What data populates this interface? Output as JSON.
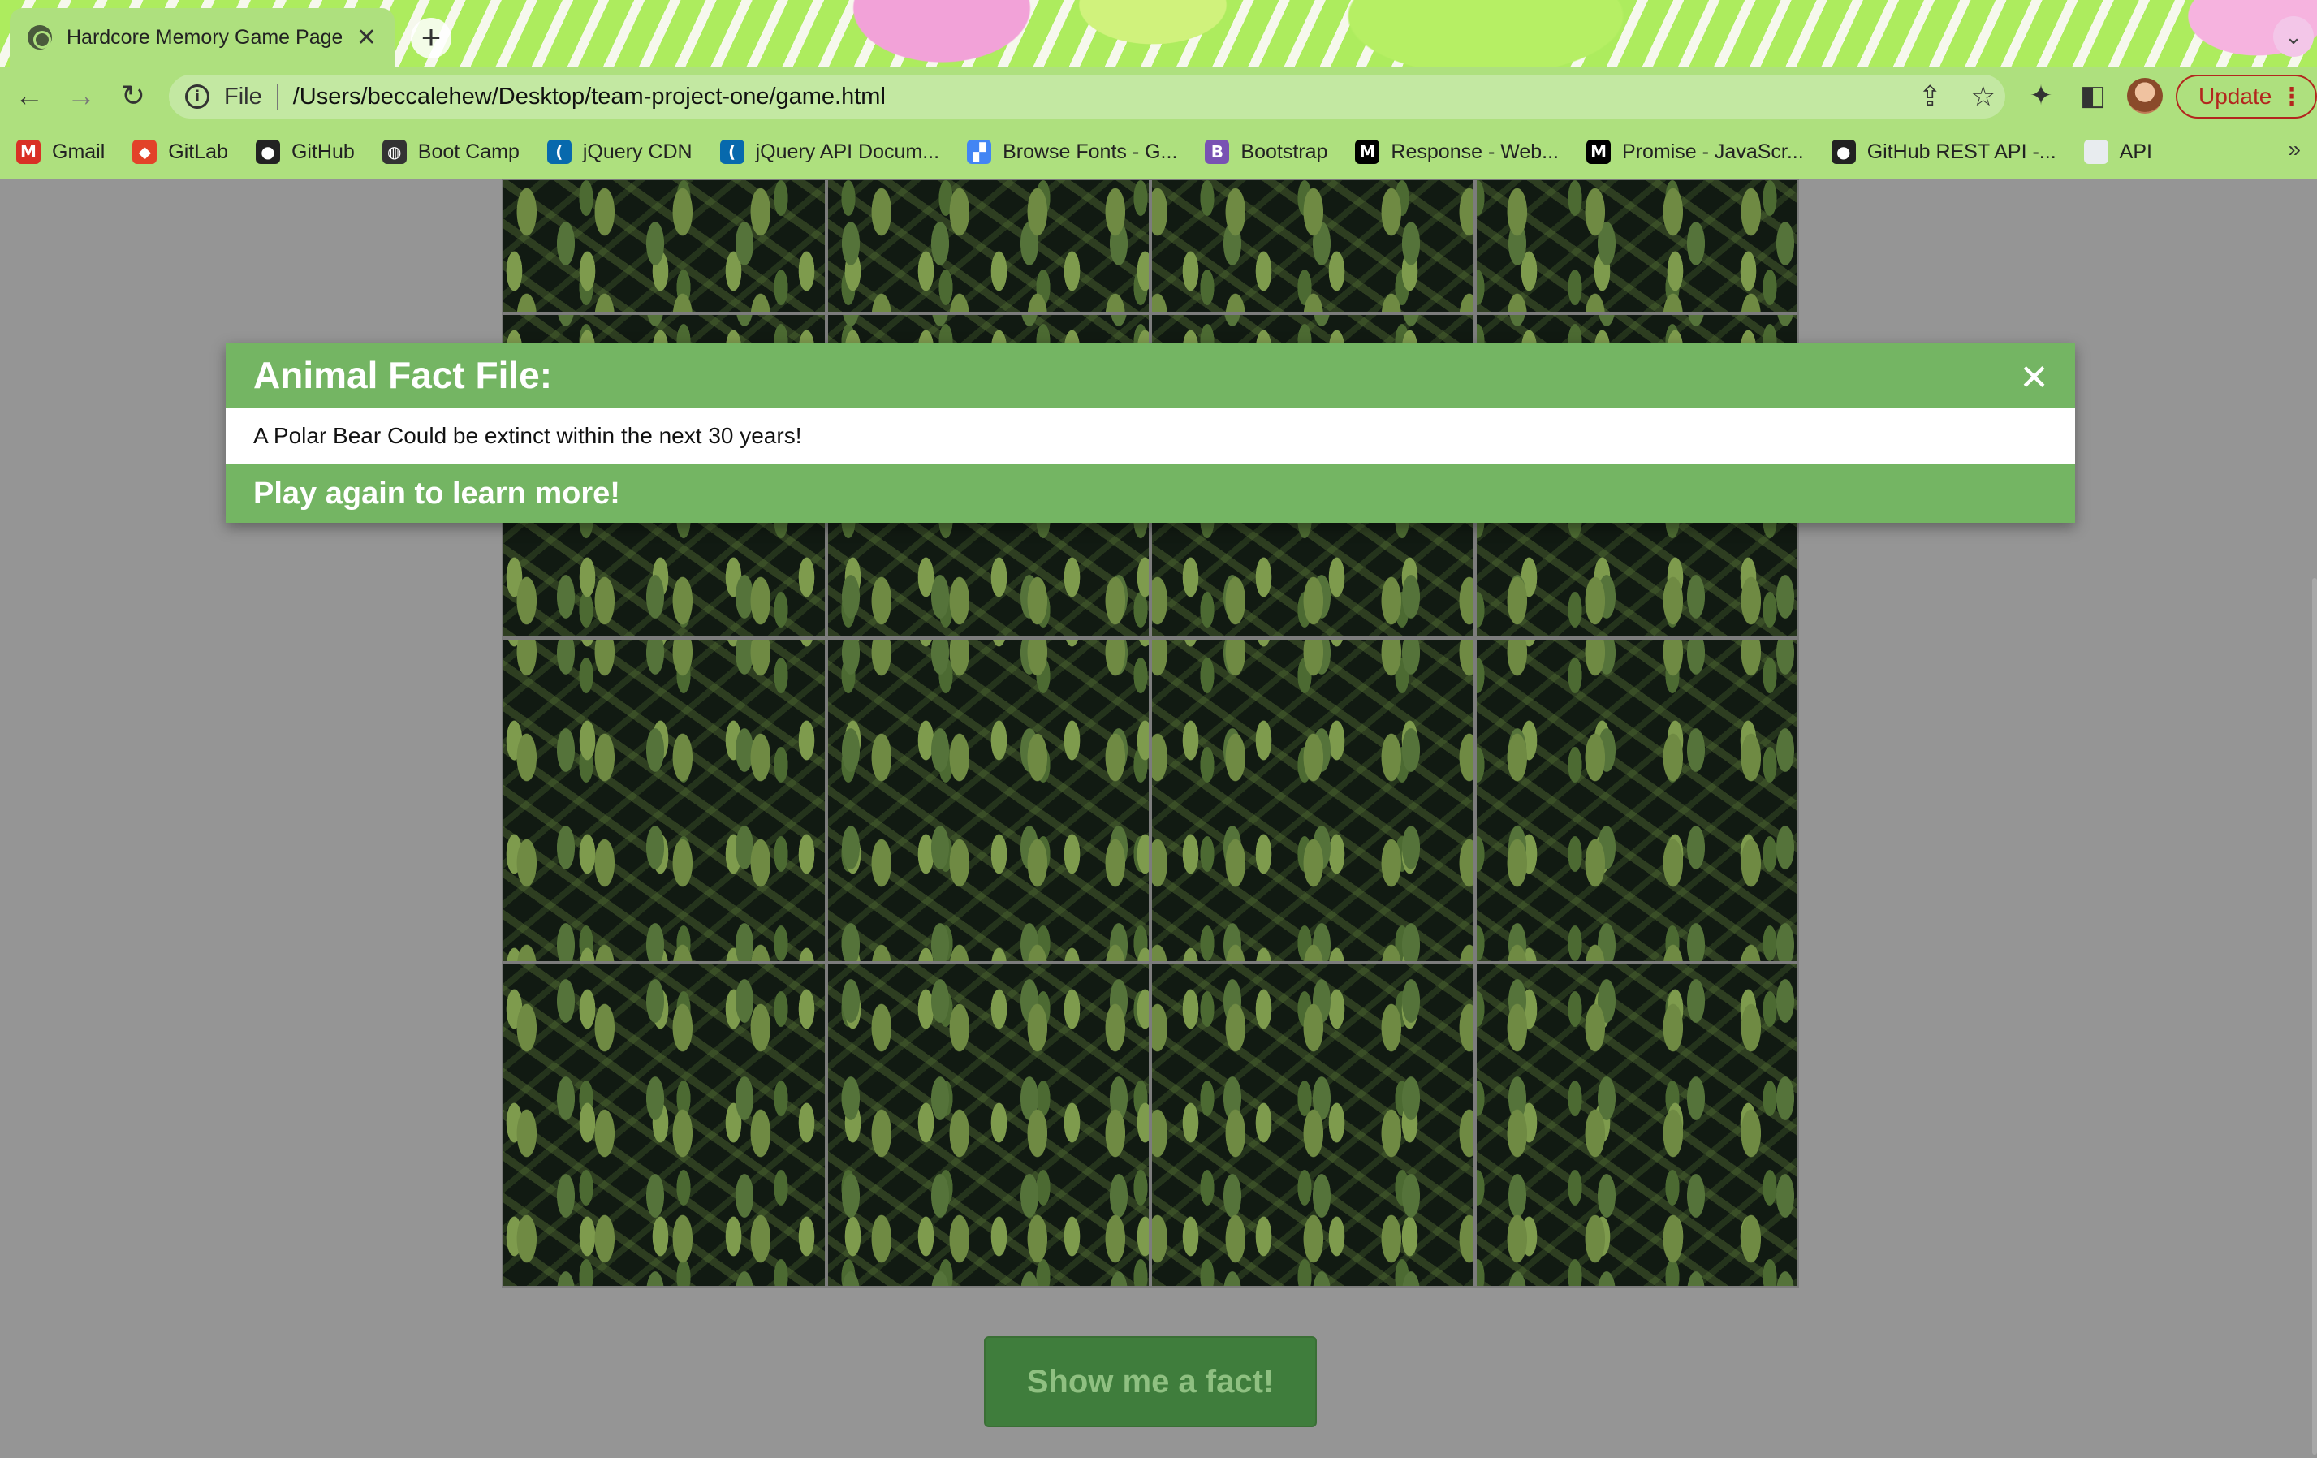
{
  "browser": {
    "tab": {
      "title": "Hardcore Memory Game Page",
      "close": "✕"
    },
    "new_tab": "+",
    "tab_list": "⌄",
    "nav": {
      "back": "←",
      "forward": "→",
      "reload": "↻"
    },
    "address": {
      "scheme": "File",
      "url": "/Users/beccalehew/Desktop/team-project-one/game.html"
    },
    "icons": {
      "share": "⇪",
      "star": "☆",
      "extensions": "✦",
      "sidepanel": "◧"
    },
    "update_label": "Update",
    "menu": "⋮",
    "bookmarks": [
      {
        "label": "Gmail",
        "icon": "gmail-icon",
        "color": "#d93025",
        "glyph": "M"
      },
      {
        "label": "GitLab",
        "icon": "gitlab-icon",
        "color": "#e24329",
        "glyph": "◆"
      },
      {
        "label": "GitHub",
        "icon": "github-icon",
        "color": "#222222",
        "glyph": "●"
      },
      {
        "label": "Boot Camp",
        "icon": "globe-icon",
        "color": "#333333",
        "glyph": "◍"
      },
      {
        "label": "jQuery CDN",
        "icon": "jquery-icon",
        "color": "#0769ad",
        "glyph": "("
      },
      {
        "label": "jQuery API Docum...",
        "icon": "jquery-icon",
        "color": "#0769ad",
        "glyph": "("
      },
      {
        "label": "Browse Fonts - G...",
        "icon": "google-fonts-icon",
        "color": "#4285f4",
        "glyph": "▞"
      },
      {
        "label": "Bootstrap",
        "icon": "bootstrap-icon",
        "color": "#7952b3",
        "glyph": "B"
      },
      {
        "label": "Response - Web...",
        "icon": "mdn-icon",
        "color": "#000000",
        "glyph": "M"
      },
      {
        "label": "Promise - JavaScr...",
        "icon": "mdn-icon",
        "color": "#000000",
        "glyph": "M"
      },
      {
        "label": "GitHub REST API -...",
        "icon": "github-icon",
        "color": "#222222",
        "glyph": "●"
      },
      {
        "label": "API",
        "icon": "folder-icon",
        "color": "#e8ecef",
        "glyph": ""
      }
    ],
    "bookmarks_more": "»"
  },
  "modal": {
    "title": "Animal Fact File:",
    "close": "✕",
    "fact": "A Polar Bear Could be extinct within the next 30 years!",
    "footer": "Play again to learn more!"
  },
  "board": {
    "rows": 4,
    "cols": 4
  },
  "fact_button": "Show me a fact!",
  "colors": {
    "modal_green": "#74b563",
    "button_green": "#3f7d3c",
    "page_bg": "#959595",
    "chrome_green": "#aee07e"
  }
}
